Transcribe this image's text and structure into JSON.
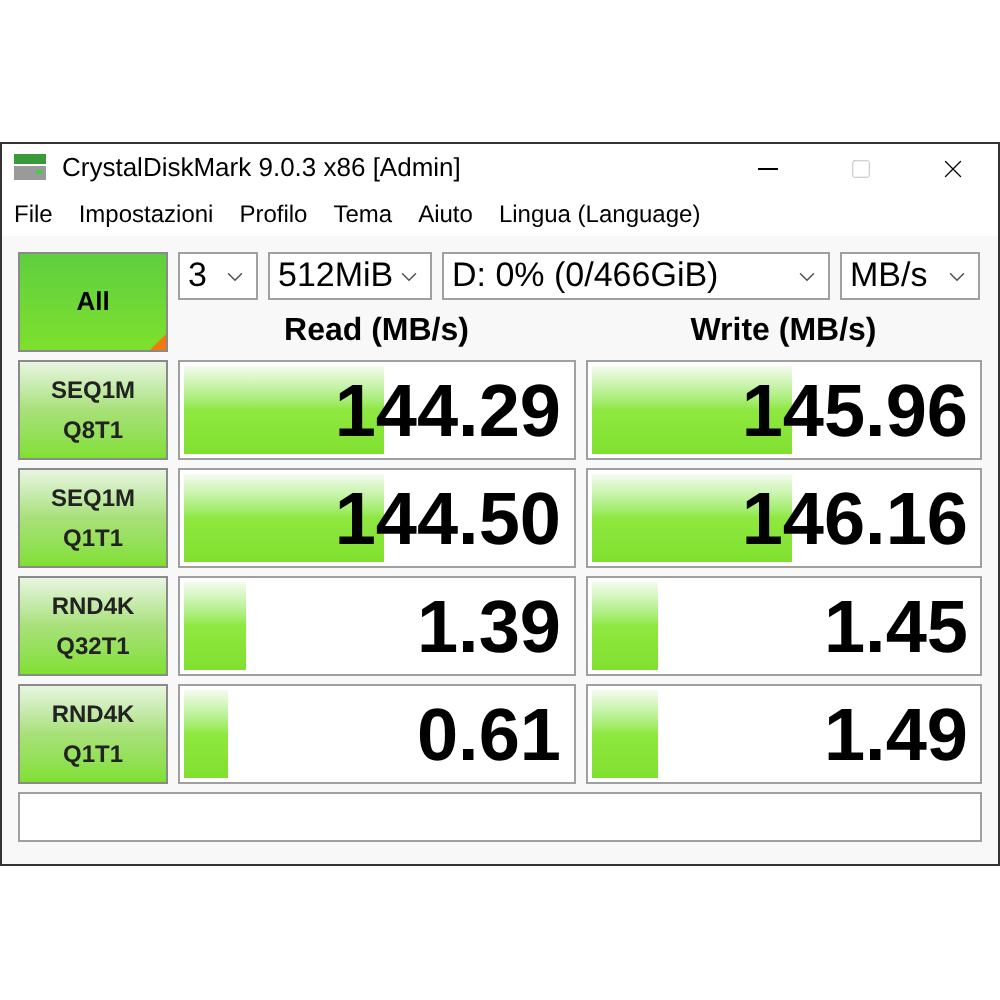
{
  "window": {
    "title": "CrystalDiskMark 9.0.3 x86 [Admin]"
  },
  "menu": [
    "File",
    "Impostazioni",
    "Profilo",
    "Tema",
    "Aiuto",
    "Lingua (Language)"
  ],
  "all_button": "All",
  "settings": {
    "count": "3",
    "size": "512MiB",
    "drive": "D: 0% (0/466GiB)",
    "unit": "MB/s"
  },
  "headers": {
    "read": "Read (MB/s)",
    "write": "Write (MB/s)"
  },
  "tests": [
    {
      "line1": "SEQ1M",
      "line2": "Q8T1",
      "read": {
        "value": "144.29",
        "level": 0.53
      },
      "write": {
        "value": "145.96",
        "level": 0.53
      }
    },
    {
      "line1": "SEQ1M",
      "line2": "Q1T1",
      "read": {
        "value": "144.50",
        "level": 0.53
      },
      "write": {
        "value": "146.16",
        "level": 0.53
      }
    },
    {
      "line1": "RND4K",
      "line2": "Q32T1",
      "read": {
        "value": "1.39",
        "level": 0.18
      },
      "write": {
        "value": "1.45",
        "level": 0.19
      }
    },
    {
      "line1": "RND4K",
      "line2": "Q1T1",
      "read": {
        "value": "0.61",
        "level": 0.13
      },
      "write": {
        "value": "1.49",
        "level": 0.19
      }
    }
  ]
}
